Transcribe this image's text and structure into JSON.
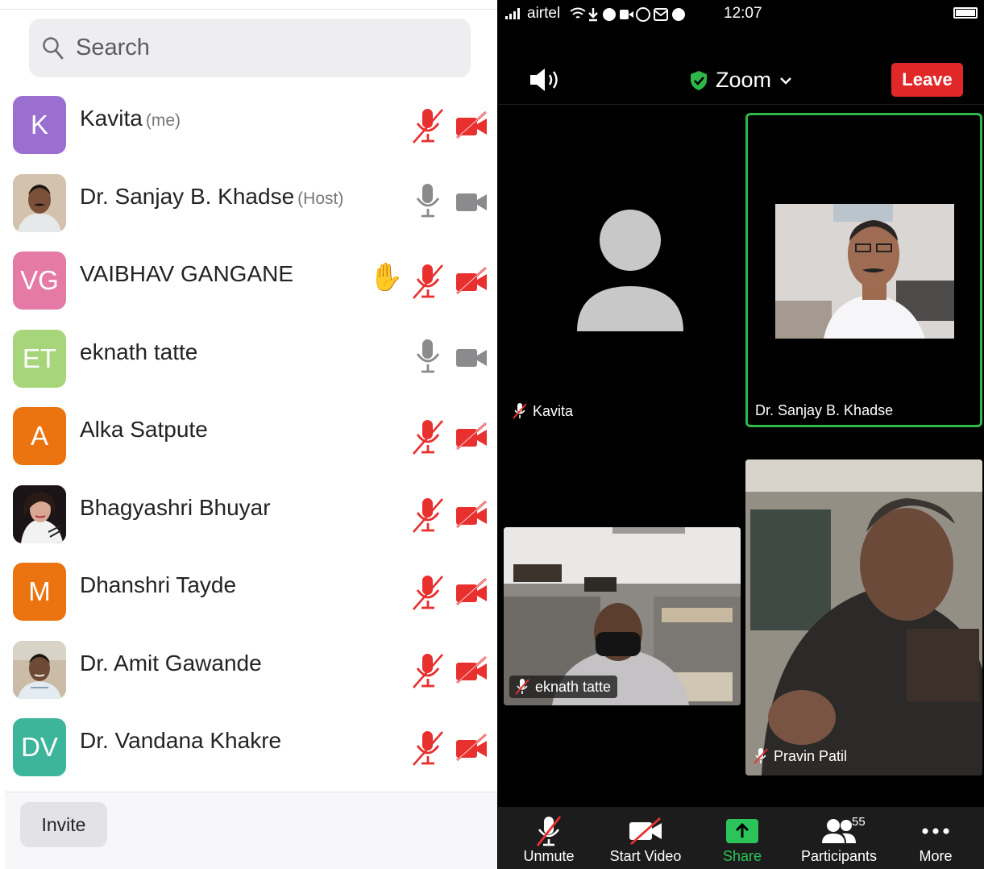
{
  "participants_panel": {
    "search_placeholder": "Search",
    "participants": [
      {
        "initials": "K",
        "name": "Kavita",
        "tag": "(me)",
        "avatar_color": "#9a6fd0",
        "mic": "muted",
        "video": "off",
        "hand": false
      },
      {
        "initials": "",
        "name": "Dr. Sanjay B. Khadse",
        "tag": "(Host)",
        "avatar_color": "#c9b49a",
        "mic": "on",
        "video": "on",
        "hand": false
      },
      {
        "initials": "VG",
        "name": "VAIBHAV GANGANE",
        "tag": "",
        "avatar_color": "#e57aa6",
        "mic": "muted",
        "video": "off",
        "hand": true
      },
      {
        "initials": "ET",
        "name": "eknath tatte",
        "tag": "",
        "avatar_color": "#a7d67a",
        "mic": "on",
        "video": "on",
        "hand": false
      },
      {
        "initials": "A",
        "name": "Alka Satpute",
        "tag": "",
        "avatar_color": "#ec7410",
        "mic": "muted",
        "video": "off",
        "hand": false
      },
      {
        "initials": "",
        "name": "Bhagyashri Bhuyar",
        "tag": "",
        "avatar_color": "#2a2024",
        "mic": "muted",
        "video": "off",
        "hand": false
      },
      {
        "initials": "M",
        "name": "Dhanshri Tayde",
        "tag": "",
        "avatar_color": "#ec7410",
        "mic": "muted",
        "video": "off",
        "hand": false
      },
      {
        "initials": "",
        "name": "Dr. Amit Gawande",
        "tag": "",
        "avatar_color": "#b7a693",
        "mic": "muted",
        "video": "off",
        "hand": false
      },
      {
        "initials": "DV",
        "name": "Dr. Vandana Khakre",
        "tag": "",
        "avatar_color": "#3db59a",
        "mic": "muted",
        "video": "off",
        "hand": false
      }
    ],
    "invite_label": "Invite"
  },
  "status_bar": {
    "carrier": "airtel",
    "time": "12:07"
  },
  "meeting": {
    "app_title": "Zoom",
    "leave_label": "Leave",
    "tiles": [
      {
        "name": "Kavita",
        "muted": true
      },
      {
        "name": "Dr. Sanjay B. Khadse",
        "muted": false
      },
      {
        "name": "eknath tatte",
        "muted": true
      },
      {
        "name": "Pravin Patil",
        "muted": true
      }
    ],
    "toolbar": {
      "unmute": "Unmute",
      "start_video": "Start Video",
      "share": "Share",
      "participants": "Participants",
      "participants_count": "55",
      "more": "More"
    }
  },
  "colors": {
    "muted_red": "#e8302f",
    "active_speaker_border": "#2fb84a",
    "leave_button": "#e02828",
    "share_green": "#2bc45a"
  }
}
